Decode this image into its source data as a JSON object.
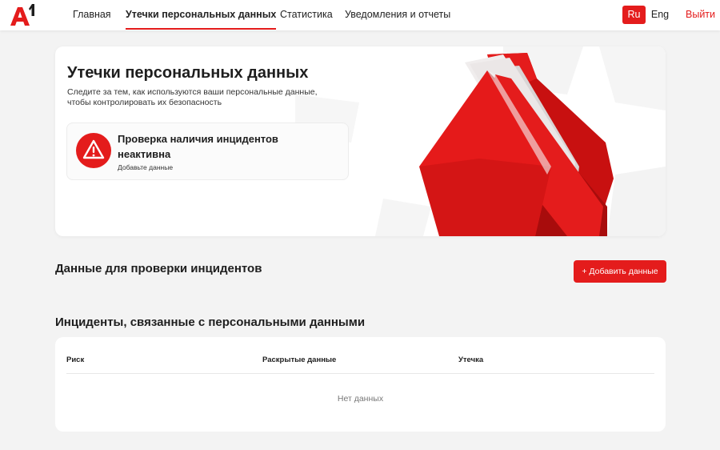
{
  "brand": {
    "logo_text": "A1",
    "accent_color": "#e41c1c"
  },
  "nav": {
    "items": [
      {
        "label": "Главная",
        "active": false
      },
      {
        "label": "Утечки персональных данных",
        "active": true
      },
      {
        "label": "Статистика",
        "active": false
      },
      {
        "label": "Уведомления и отчеты",
        "active": false
      }
    ],
    "languages": [
      {
        "label": "Ru",
        "active": true
      },
      {
        "label": "Eng",
        "active": false
      }
    ],
    "logout_label": "Выйти"
  },
  "hero": {
    "title": "Утечки персональных данных",
    "description": "Следите за тем, как используются ваши персональные данные, чтобы контролировать их безопасность",
    "status": {
      "icon": "warning-icon",
      "title": "Проверка наличия инцидентов неактивна",
      "subtitle": "Добавьте данные"
    }
  },
  "data_section": {
    "title": "Данные для проверки инцидентов",
    "add_button_label": "+ Добавить данные"
  },
  "incidents_section": {
    "title": "Инциденты, связанные с персональными данными",
    "columns": [
      "Риск",
      "Раскрытые данные",
      "Утечка"
    ],
    "empty_text": "Нет данных"
  }
}
